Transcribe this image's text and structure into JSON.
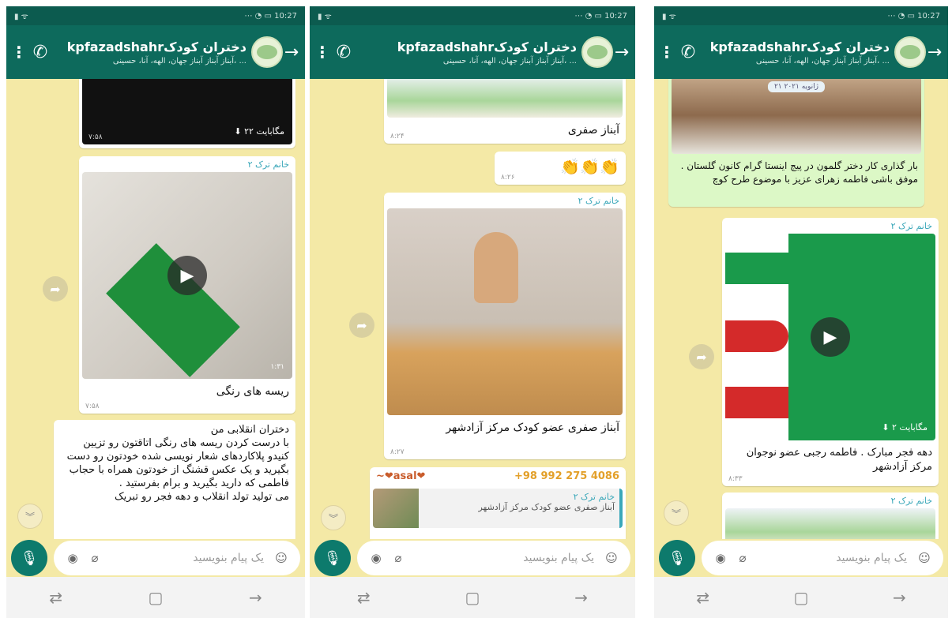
{
  "chat": {
    "title": "kpfazadshahrدختران کودک",
    "subtitle": "آبناز آبناز آبناز جهان، الهه، آنا، حسینی، ..."
  },
  "input": {
    "placeholder": "یک پیام بنویسید"
  },
  "s1": {
    "video1_size": "۲۲ مگابایت",
    "video1_time": "۷:۵۸",
    "msg2_sender": "خانم ترک ۲",
    "msg2_duration": "۱:۳۱",
    "msg2_caption": "ریسه های رنگی",
    "msg2_time": "۷:۵۸",
    "msg3_text": "دختران انقلابی من\nبا درست کردن ریسه های رنگی اتاقتون رو تزیین کنیدو پلاکاردهای شعار نویسی شده خودتون رو دست بگیرید و یک عکس قشنگ از خودتون همراه با حجاب فاطمی که دارید بگیرید و برام بفرستید .\nمی تولید تولد انقلاب و دهه فجر رو تبریک"
  },
  "s2": {
    "msg1_caption": "آبناز صفری",
    "msg1_time": "۸:۲۴",
    "msg2_emoji": "👏👏👏",
    "msg2_time": "۸:۲۶",
    "msg3_sender": "خانم ترک ۲",
    "msg3_caption": "آبناز صفری عضو کودک مرکز آزادشهر",
    "msg3_time": "۸:۲۷",
    "reply_sender_name": "~❤asal❤",
    "reply_sender_phone": "+98 992 275 4086",
    "reply_quote_sender": "خانم ترک ۲",
    "reply_quote_text": "آبناز صفری عضو کودک مرکز آزادشهر"
  },
  "s3": {
    "date_chip": "۲۱ ژانویه ۲۰۲۱",
    "msg1_caption": "بار گذاری کار دختر گلمون در پیج اینستا گرام کانون گلستان . موفق باشی فاطمه زهرای عزیز با موضوع طرح کوچ",
    "msg2_sender": "خانم ترک ۲",
    "msg2_size": "۲ مگابایت",
    "msg2_caption": "دهه فجر مبارک . فاطمه رجبی عضو نوجوان مرکز آزادشهر",
    "msg2_time": "۸:۳۳",
    "msg3_sender": "خانم ترک ۲"
  }
}
